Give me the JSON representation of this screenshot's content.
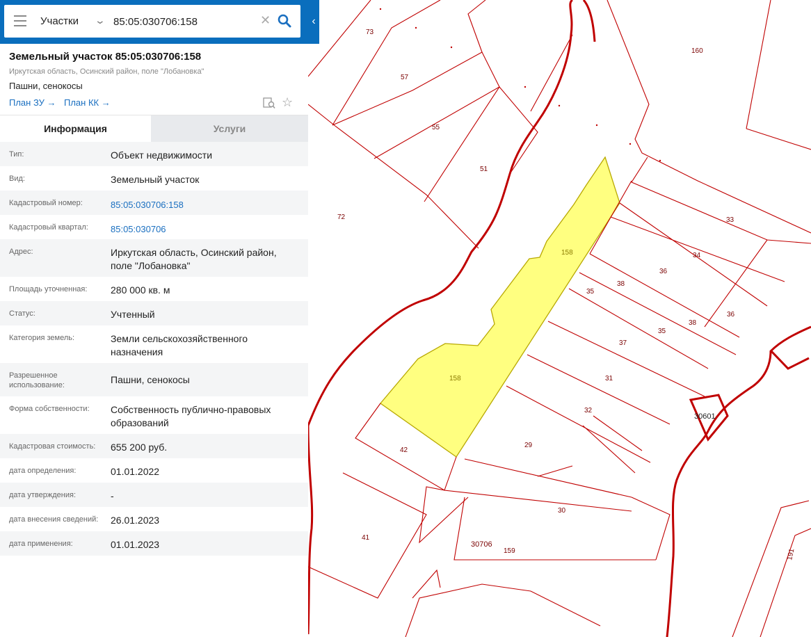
{
  "search": {
    "type_label": "Участки",
    "value": "85:05:030706:158"
  },
  "object": {
    "title": "Земельный участок 85:05:030706:158",
    "address": "Иркутская область, Осинский район, поле \"Лобановка\"",
    "usage": "Пашни, сенокосы",
    "plan_zu_label": "План ЗУ →",
    "plan_kk_label": "План КК →"
  },
  "tabs": {
    "info": "Информация",
    "services": "Услуги"
  },
  "info_rows": [
    {
      "label": "Тип:",
      "value": "Объект недвижимости"
    },
    {
      "label": "Вид:",
      "value": "Земельный участок"
    },
    {
      "label": "Кадастровый номер:",
      "value": "85:05:030706:158"
    },
    {
      "label": "Кадастровый квартал:",
      "value": "85:05:030706"
    },
    {
      "label": "Адрес:",
      "value": "Иркутская область, Осинский район, поле \"Лобановка\""
    },
    {
      "label": "Площадь уточненная:",
      "value": "280 000 кв. м"
    },
    {
      "label": "Статус:",
      "value": "Учтенный"
    },
    {
      "label": "Категория земель:",
      "value": "Земли сельскохозяйственного назначения"
    },
    {
      "label": "Разрешенное использование:",
      "value": "Пашни, сенокосы"
    },
    {
      "label": "Форма собственности:",
      "value": "Собственность публично-правовых образований"
    },
    {
      "label": "Кадастровая стоимость:",
      "value": "655 200 руб."
    },
    {
      "label": "дата определения:",
      "value": "01.01.2022"
    },
    {
      "label": "дата утверждения:",
      "value": "-"
    },
    {
      "label": "дата внесения сведений:",
      "value": "26.01.2023"
    },
    {
      "label": "дата применения:",
      "value": "01.01.2023"
    }
  ],
  "map": {
    "parcel_labels": {
      "p73": "73",
      "p160": "160",
      "p57": "57",
      "p55": "55",
      "p51": "51",
      "p72": "72",
      "p33": "33",
      "p34": "34",
      "p158a": "158",
      "p36a": "36",
      "p38a": "38",
      "p35a": "35",
      "p36b": "36",
      "p35b": "35",
      "p38b": "38",
      "p37": "37",
      "p158b": "158",
      "p31": "31",
      "p30601": "30601",
      "p32": "32",
      "p42": "42",
      "p29": "29",
      "p30": "30",
      "p41": "41",
      "p30706": "30706",
      "p159": "159",
      "p191": "191"
    },
    "colors": {
      "boundary": "#c00000",
      "selected_fill": "#ffff80",
      "selected_stroke": "#b8a800"
    }
  }
}
